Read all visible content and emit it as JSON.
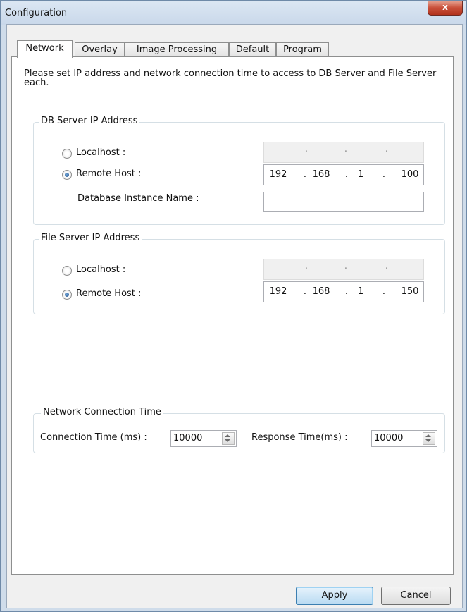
{
  "window": {
    "title": "Configuration",
    "close_glyph": "x"
  },
  "tabs": [
    {
      "label": "Network",
      "active": true
    },
    {
      "label": "Overlay",
      "active": false
    },
    {
      "label": "Image Processing",
      "active": false
    },
    {
      "label": "Default",
      "active": false
    },
    {
      "label": "Program",
      "active": false
    }
  ],
  "description": "Please set IP address and network connection time to access to DB Server and File Server each.",
  "db_server": {
    "group_label": "DB Server IP Address",
    "localhost_label": "Localhost :",
    "remote_label": "Remote Host :",
    "selected": "remote",
    "localhost_ip": [
      "",
      "",
      "",
      ""
    ],
    "remote_ip": [
      "192",
      "168",
      "1",
      "100"
    ],
    "instance_label": "Database Instance Name :",
    "instance_value": ""
  },
  "file_server": {
    "group_label": "File Server IP Address",
    "localhost_label": "Localhost :",
    "remote_label": "Remote Host :",
    "selected": "remote",
    "localhost_ip": [
      "",
      "",
      "",
      ""
    ],
    "remote_ip": [
      "192",
      "168",
      "1",
      "150"
    ]
  },
  "network_time": {
    "group_label": "Network Connection Time",
    "connection_label": "Connection Time (ms) :",
    "connection_value": "10000",
    "response_label": "Response Time(ms) :",
    "response_value": "10000"
  },
  "buttons": {
    "apply": "Apply",
    "cancel": "Cancel"
  },
  "colors": {
    "title_bar": "#c9d8ea",
    "close_button": "#c9503a",
    "default_button": "#b9dbf2"
  }
}
